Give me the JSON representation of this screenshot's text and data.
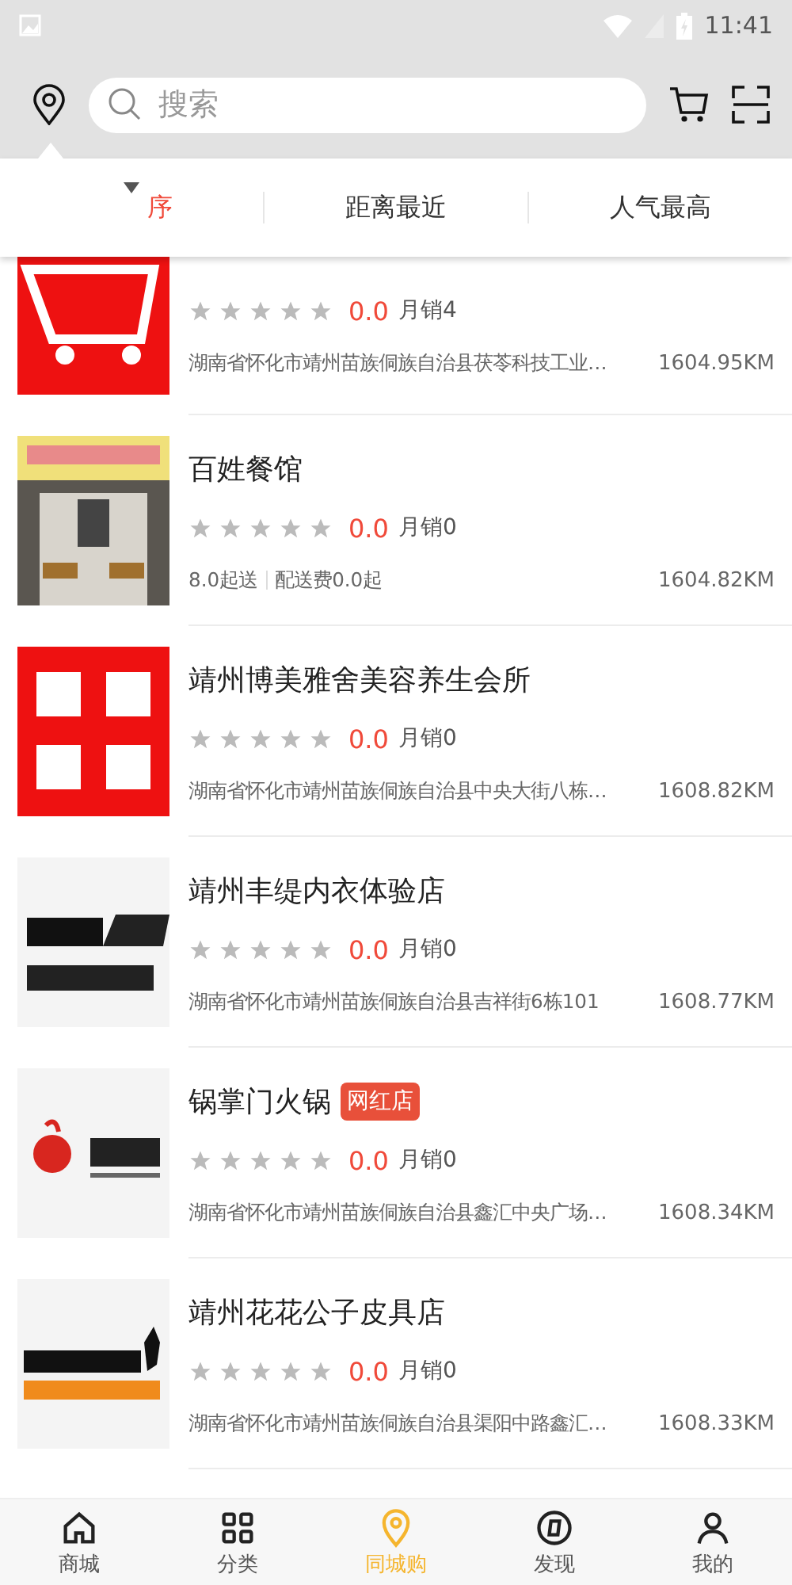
{
  "status_bar": {
    "time": "11:41"
  },
  "header": {
    "search": {
      "placeholder": "搜索"
    }
  },
  "sort_tabs": [
    {
      "label": "序",
      "selected": true
    },
    {
      "label": "距离最近",
      "selected": false
    },
    {
      "label": "人气最高",
      "selected": false
    }
  ],
  "stores": [
    {
      "kind": "address",
      "cut": true,
      "stars": 0,
      "rating": "0.0",
      "sales": "月销4",
      "address": "湖南省怀化市靖州苗族侗族自治县茯苓科技工业…",
      "distance": "1604.95KM"
    },
    {
      "kind": "delivery",
      "title": "百姓餐馆",
      "stars": 0,
      "rating": "0.0",
      "sales": "月销0",
      "min_order": "8.0起送",
      "delivery_fee": "配送费0.0起",
      "distance": "1604.82KM"
    },
    {
      "kind": "address",
      "title": "靖州博美雅舍美容养生会所",
      "stars": 0,
      "rating": "0.0",
      "sales": "月销0",
      "address": "湖南省怀化市靖州苗族侗族自治县中央大街八栋…",
      "distance": "1608.82KM"
    },
    {
      "kind": "address",
      "title": "靖州丰缇内衣体验店",
      "stars": 0,
      "rating": "0.0",
      "sales": "月销0",
      "address": "湖南省怀化市靖州苗族侗族自治县吉祥街6栋101",
      "distance": "1608.77KM"
    },
    {
      "kind": "address",
      "title": "锅掌门火锅",
      "badge": "网红店",
      "stars": 0,
      "rating": "0.0",
      "sales": "月销0",
      "address": "湖南省怀化市靖州苗族侗族自治县鑫汇中央广场…",
      "distance": "1608.34KM"
    },
    {
      "kind": "address",
      "title": "靖州花花公子皮具店",
      "stars": 0,
      "rating": "0.0",
      "sales": "月销0",
      "address": "湖南省怀化市靖州苗族侗族自治县渠阳中路鑫汇…",
      "distance": "1608.33KM"
    }
  ],
  "bottom_nav": [
    {
      "label": "商城",
      "selected": false
    },
    {
      "label": "分类",
      "selected": false
    },
    {
      "label": "同城购",
      "selected": true
    },
    {
      "label": "发现",
      "selected": false
    },
    {
      "label": "我的",
      "selected": false
    }
  ]
}
